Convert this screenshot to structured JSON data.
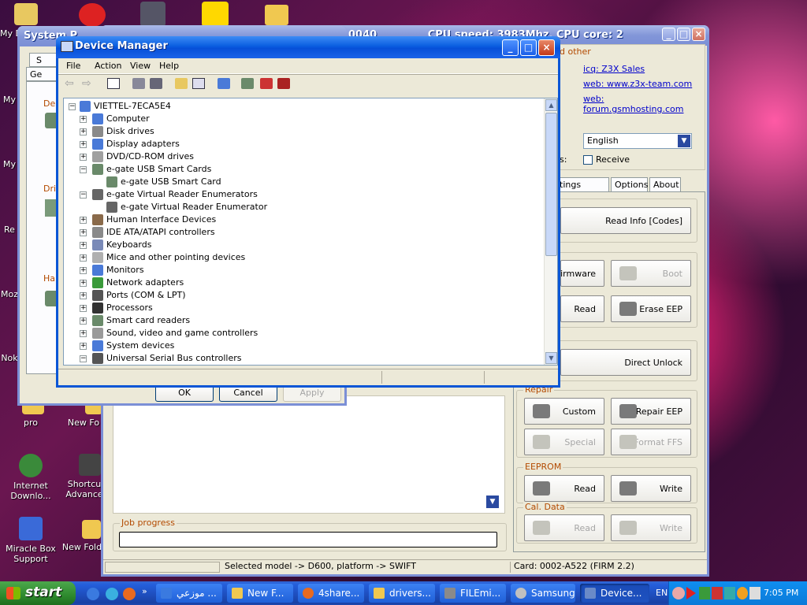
{
  "desktop": {
    "icons": [
      {
        "id": "my-docs",
        "label": "My D",
        "color": "#e8c860"
      },
      {
        "id": "my-comp",
        "label": "My",
        "color": "#9ab"
      },
      {
        "id": "my-net",
        "label": "My",
        "color": "#9ab"
      },
      {
        "id": "recycle",
        "label": "Re",
        "color": "#9ab"
      },
      {
        "id": "mozilla",
        "label": "Moz",
        "color": "#e86"
      },
      {
        "id": "nokia",
        "label": "Nok",
        "color": "#68c"
      },
      {
        "id": "pro",
        "label": "pro",
        "color": "#f0c850"
      },
      {
        "id": "newfolder1",
        "label": "New Fo",
        "color": "#f0c850"
      },
      {
        "id": "idm",
        "label": "Internet Downlo...",
        "color": "#3a8a3a"
      },
      {
        "id": "shortcut",
        "label": "Shortcu Advance",
        "color": "#444"
      },
      {
        "id": "miracle",
        "label": "Miracle Box Support",
        "color": "#3a6ad8"
      },
      {
        "id": "newfolder2",
        "label": "New Fold",
        "color": "#f0c850"
      }
    ]
  },
  "z3x": {
    "title_fragments": [
      "0040",
      "CPU speed: 3983Mhz, CPU core: 2"
    ],
    "links_heading": "d other",
    "links": [
      "icq: Z3X Sales",
      "web: www.z3x-team.com",
      "web: forum.gsmhosting.com"
    ],
    "language": "English",
    "receive_prefix": "s:",
    "receive_label": "Receive",
    "tabs": [
      "tings model",
      "Options",
      "About"
    ],
    "buttons": {
      "read_info": "Read Info [Codes]",
      "firmware": "Firmware",
      "boot": "Boot",
      "read": "Read",
      "erase_eep": "Erase EEP",
      "direct_unlock": "Direct Unlock",
      "custom": "Custom",
      "repair_eep": "Repair EEP",
      "special": "Special",
      "format_ffs": "Format FFS",
      "eeprom_read": "Read",
      "eeprom_write": "Write",
      "cal_read": "Read",
      "cal_write": "Write"
    },
    "groups": {
      "repair": "Repair",
      "eeprom": "EEPROM",
      "cal": "Cal. Data"
    },
    "job_progress": "Job progress",
    "status_left": "Selected model -> D600, platform -> SWIFT",
    "status_right": "Card: 0002-A522 (FIRM 2.2)"
  },
  "sysprops": {
    "title": "System P",
    "tab_fragments": [
      "S",
      "Ge"
    ],
    "labels": [
      "De",
      "Driv",
      "Har"
    ],
    "ok": "OK",
    "cancel": "Cancel",
    "apply": "Apply"
  },
  "devmgr": {
    "title": "Device Manager",
    "menu": [
      "File",
      "Action",
      "View",
      "Help"
    ],
    "root": "VIETTEL-7ECA5E4",
    "tree": [
      {
        "label": "Computer",
        "level": 1,
        "exp": "+",
        "color": "#4a7ad8"
      },
      {
        "label": "Disk drives",
        "level": 1,
        "exp": "+",
        "color": "#8a8a8a"
      },
      {
        "label": "Display adapters",
        "level": 1,
        "exp": "+",
        "color": "#4a7ad8"
      },
      {
        "label": "DVD/CD-ROM drives",
        "level": 1,
        "exp": "+",
        "color": "#a0a0a0"
      },
      {
        "label": "e-gate USB Smart Cards",
        "level": 1,
        "exp": "-",
        "color": "#6a8a6a"
      },
      {
        "label": "e-gate USB Smart Card",
        "level": 2,
        "exp": "",
        "color": "#6a8a6a"
      },
      {
        "label": "e-gate Virtual Reader Enumerators",
        "level": 1,
        "exp": "-",
        "color": "#666"
      },
      {
        "label": "e-gate Virtual Reader Enumerator",
        "level": 2,
        "exp": "",
        "color": "#666"
      },
      {
        "label": "Human Interface Devices",
        "level": 1,
        "exp": "+",
        "color": "#8a6a4a"
      },
      {
        "label": "IDE ATA/ATAPI controllers",
        "level": 1,
        "exp": "+",
        "color": "#8a8a8a"
      },
      {
        "label": "Keyboards",
        "level": 1,
        "exp": "+",
        "color": "#7a8ab8"
      },
      {
        "label": "Mice and other pointing devices",
        "level": 1,
        "exp": "+",
        "color": "#b0b0b0"
      },
      {
        "label": "Monitors",
        "level": 1,
        "exp": "+",
        "color": "#4a7ad8"
      },
      {
        "label": "Network adapters",
        "level": 1,
        "exp": "+",
        "color": "#3a9a3a"
      },
      {
        "label": "Ports (COM & LPT)",
        "level": 1,
        "exp": "+",
        "color": "#555"
      },
      {
        "label": "Processors",
        "level": 1,
        "exp": "+",
        "color": "#333"
      },
      {
        "label": "Smart card readers",
        "level": 1,
        "exp": "+",
        "color": "#6a8a6a"
      },
      {
        "label": "Sound, video and game controllers",
        "level": 1,
        "exp": "+",
        "color": "#9a9a9a"
      },
      {
        "label": "System devices",
        "level": 1,
        "exp": "+",
        "color": "#4a7ad8"
      },
      {
        "label": "Universal Serial Bus controllers",
        "level": 1,
        "exp": "-",
        "color": "#555"
      }
    ]
  },
  "taskbar": {
    "start": "start",
    "items": [
      {
        "label": "موزعي ...",
        "color": "#3a7ae0"
      },
      {
        "label": "New F...",
        "color": "#f0c850"
      },
      {
        "label": "4share...",
        "color": "#e86a20"
      },
      {
        "label": "drivers...",
        "color": "#f0c850"
      },
      {
        "label": "FILEmi...",
        "color": "#8a8a8a"
      },
      {
        "label": "Samsung",
        "color": "#c0c0c0"
      },
      {
        "label": "Device...",
        "color": "#6a8ac8",
        "active": true
      }
    ],
    "lang": "EN",
    "clock": "7:05 PM"
  }
}
